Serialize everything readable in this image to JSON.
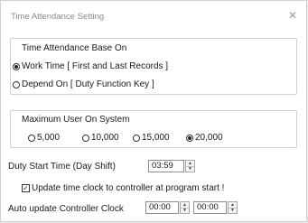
{
  "window": {
    "title": "Time Attendance Setting",
    "close_glyph": "✕"
  },
  "base_on": {
    "title": "Time Attendance Base On",
    "options": [
      {
        "label": "Work Time [ First and Last Records ]",
        "selected": true
      },
      {
        "label": "Depend On [ Duty Function Key ]",
        "selected": false
      }
    ]
  },
  "max_user": {
    "title": "Maximum User On System",
    "options": [
      {
        "label": "5,000",
        "selected": false
      },
      {
        "label": "10,000",
        "selected": false
      },
      {
        "label": "15,000",
        "selected": false
      },
      {
        "label": "20,000",
        "selected": true
      }
    ]
  },
  "duty_start": {
    "label": "Duty Start Time (Day Shift)",
    "value": "03:59"
  },
  "update_clock": {
    "label": "Update time clock to controller at program start !",
    "checked": true,
    "check_glyph": "✓"
  },
  "auto_update": {
    "label": "Auto update Controller Clock",
    "value1": "00:00",
    "value2": "00:00"
  },
  "icons": {
    "spin_up": "▲",
    "spin_down": "▼"
  }
}
